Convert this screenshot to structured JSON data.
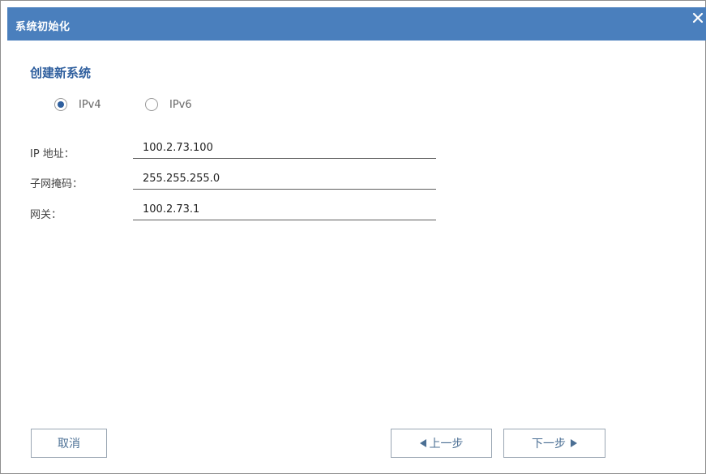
{
  "dialog": {
    "title": "系统初始化",
    "section_title": "创建新系统"
  },
  "radios": [
    {
      "label": "IPv4",
      "checked": true
    },
    {
      "label": "IPv6",
      "checked": false
    }
  ],
  "form": {
    "ip_label": "IP 地址：",
    "ip_value": "100.2.73.100",
    "mask_label": "子网掩码：",
    "mask_value": "255.255.255.0",
    "gateway_label": "网关：",
    "gateway_value": "100.2.73.1"
  },
  "buttons": {
    "cancel": "取消",
    "prev": "上一步",
    "next": "下一步"
  },
  "colors": {
    "titlebar": "#4a7fbd",
    "accent": "#2f5f9e",
    "button_text": "#4b6f94"
  },
  "icons": {
    "close": "close-icon",
    "prev": "arrow-left-icon",
    "next": "arrow-right-icon"
  }
}
